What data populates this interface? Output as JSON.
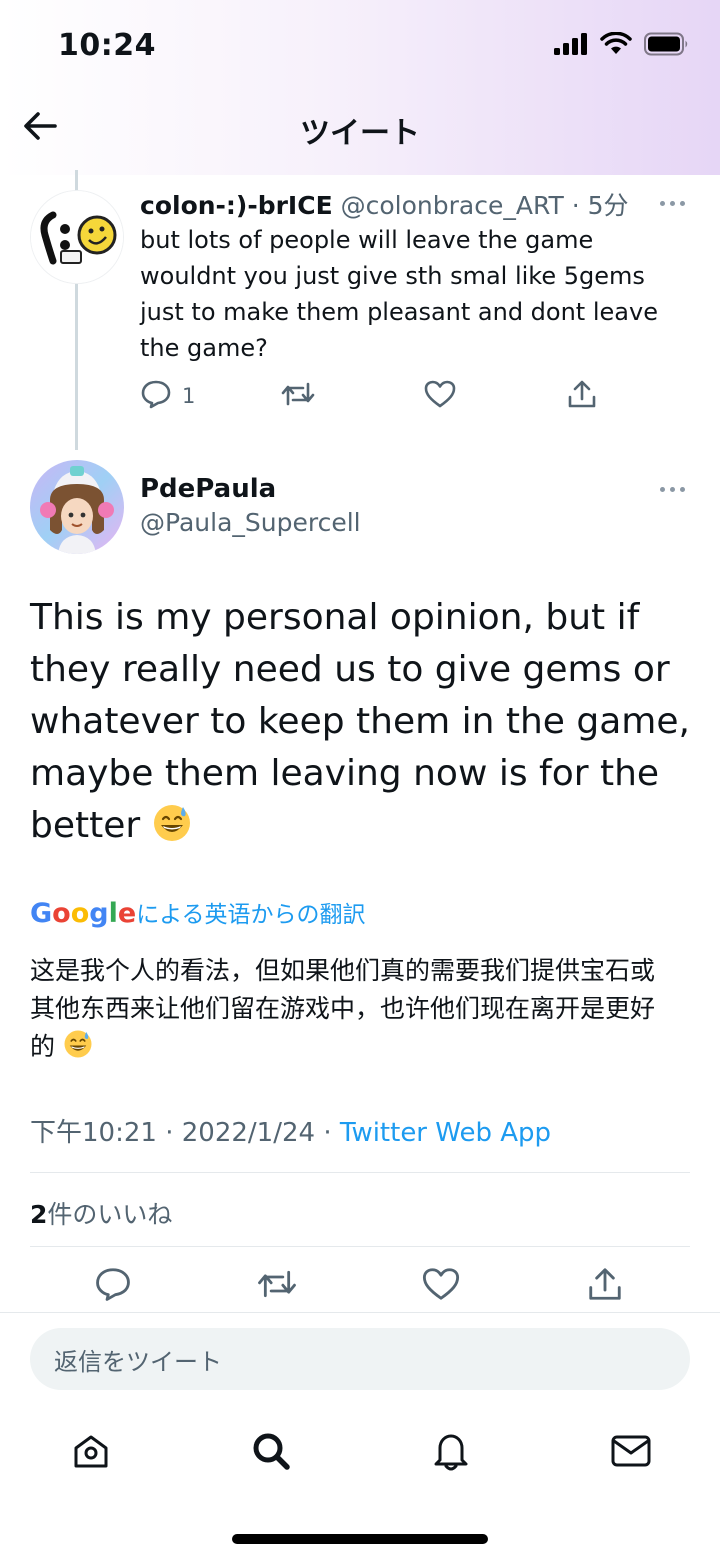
{
  "status_bar": {
    "time": "10:24"
  },
  "header": {
    "title": "ツイート"
  },
  "reply_tweet": {
    "name": "colon-:)-brICE",
    "handle": "@colonbrace_ART",
    "separator": "·",
    "time_ago": "5分",
    "text": "but lots of people will leave the game wouldnt you just give sth smal like 5gems just to make them pleasant and dont leave the game?",
    "reply_count": "1"
  },
  "main_tweet": {
    "name": "PdePaula",
    "handle": "@Paula_Supercell",
    "text": "This is my personal opinion, but if they really need us to give gems or whatever to keep them in the game, maybe them leaving now is for the better",
    "translation_brand": "Google",
    "translation_suffix": "による英语からの翻訳",
    "translated_text": "这是我个人的看法，但如果他们真的需要我们提供宝石或其他东西来让他们留在游戏中，也许他们现在离开是更好的",
    "time": "下午10:21",
    "date": "2022/1/24",
    "source": "Twitter Web App",
    "likes_count": "2",
    "likes_suffix": "件のいいね"
  },
  "reply_box": {
    "placeholder": "返信をツイート"
  },
  "icons": {
    "back": "arrow-left-icon",
    "more": "more-horizontal-icon",
    "reply": "speech-bubble-icon",
    "retweet": "retweet-icon",
    "like": "heart-icon",
    "share": "share-icon",
    "home": "home-icon",
    "search": "search-icon",
    "notifications": "bell-icon",
    "messages": "envelope-icon",
    "emoji": "grinning-sweat-emoji"
  },
  "colors": {
    "accent": "#1d9bf0",
    "text_primary": "#0f1419",
    "text_secondary": "#536471",
    "divider": "#e5e9ec",
    "input_bg": "#eff3f4"
  }
}
